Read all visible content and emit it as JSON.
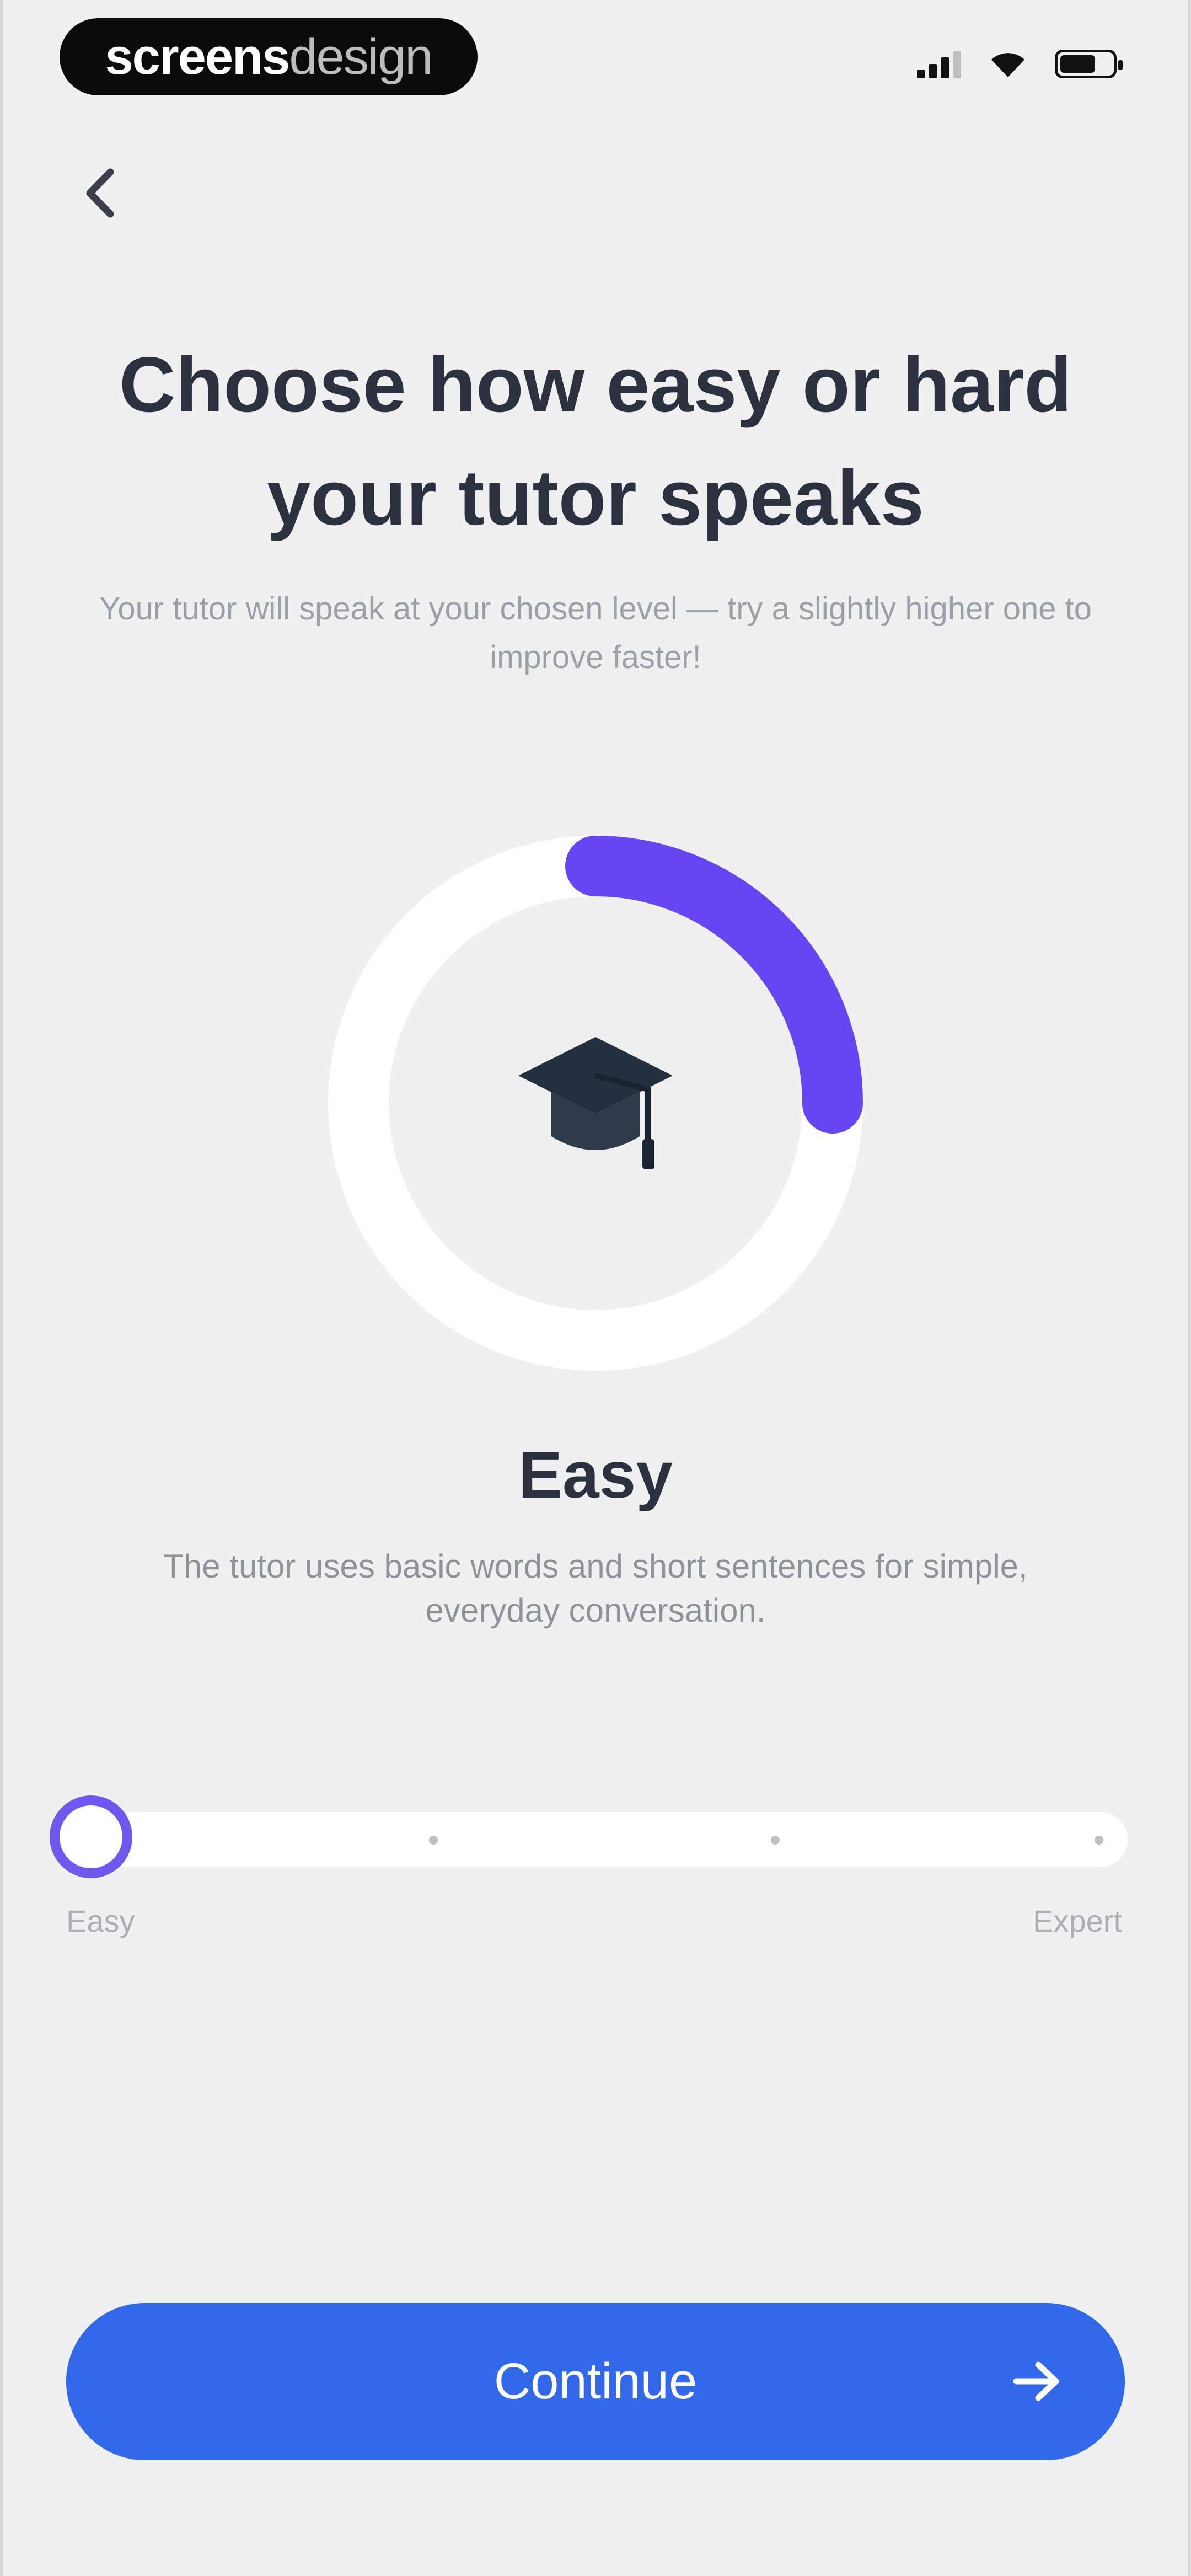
{
  "status_bar": {
    "brand_part1": "screens",
    "brand_part2": "design"
  },
  "header": {
    "back_icon": "chevron-left-icon"
  },
  "main": {
    "title": "Choose how easy or hard your tutor speaks",
    "subtitle": "Your tutor will speak at your chosen level — try a slightly higher one to improve faster!",
    "ring": {
      "icon": "graduation-cap-icon",
      "progress_fraction": 0.25
    },
    "level_name": "Easy",
    "level_description": "The tutor uses basic words and short sentences for simple, everyday conversation."
  },
  "slider": {
    "min_label": "Easy",
    "max_label": "Expert",
    "steps": 4,
    "selected_index": 0
  },
  "footer": {
    "continue_label": "Continue",
    "continue_icon": "arrow-right-icon"
  },
  "colors": {
    "accent_purple": "#6e58f0",
    "button_blue": "#3169ea",
    "title": "#2c3140",
    "background": "#f0f0f0"
  }
}
